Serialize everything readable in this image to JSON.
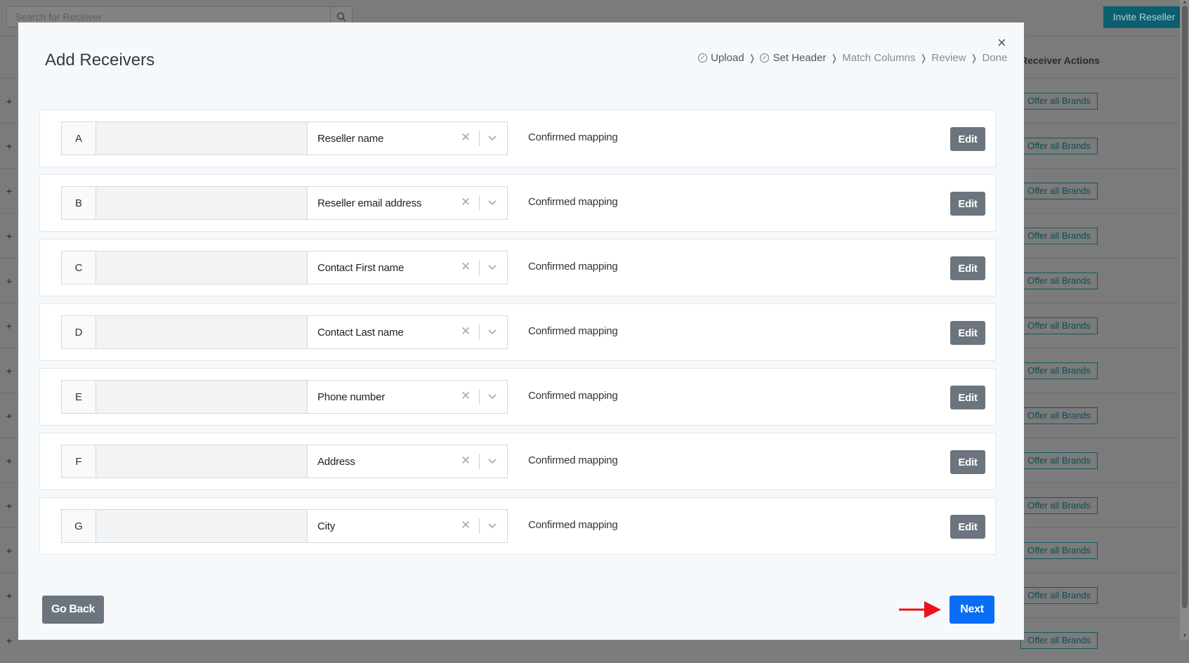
{
  "background": {
    "search_placeholder": "Search for Receiver",
    "invite_button": "Invite Reseller",
    "column_header": "Receiver Actions",
    "row_action_label": "Offer all Brands",
    "row_expand_symbol": "+",
    "row_count": 13
  },
  "modal": {
    "title": "Add Receivers",
    "close_symbol": "×",
    "steps": [
      {
        "label": "Upload",
        "done": true
      },
      {
        "label": "Set Header",
        "done": true
      },
      {
        "label": "Match Columns",
        "done": false
      },
      {
        "label": "Review",
        "done": false
      },
      {
        "label": "Done",
        "done": false
      }
    ],
    "step_separator": "❭",
    "mappings": [
      {
        "letter": "A",
        "field": "Reseller name",
        "status": "Confirmed mapping",
        "action": "Edit"
      },
      {
        "letter": "B",
        "field": "Reseller email address",
        "status": "Confirmed mapping",
        "action": "Edit"
      },
      {
        "letter": "C",
        "field": "Contact First name",
        "status": "Confirmed mapping",
        "action": "Edit"
      },
      {
        "letter": "D",
        "field": "Contact Last name",
        "status": "Confirmed mapping",
        "action": "Edit"
      },
      {
        "letter": "E",
        "field": "Phone number",
        "status": "Confirmed mapping",
        "action": "Edit"
      },
      {
        "letter": "F",
        "field": "Address",
        "status": "Confirmed mapping",
        "action": "Edit"
      },
      {
        "letter": "G",
        "field": "City",
        "status": "Confirmed mapping",
        "action": "Edit"
      }
    ],
    "go_back_label": "Go Back",
    "next_label": "Next"
  },
  "colors": {
    "primary": "#0a6ef5",
    "secondary": "#6c757d",
    "annotation_arrow": "#e8131b",
    "teal": "#0b5f6f"
  }
}
